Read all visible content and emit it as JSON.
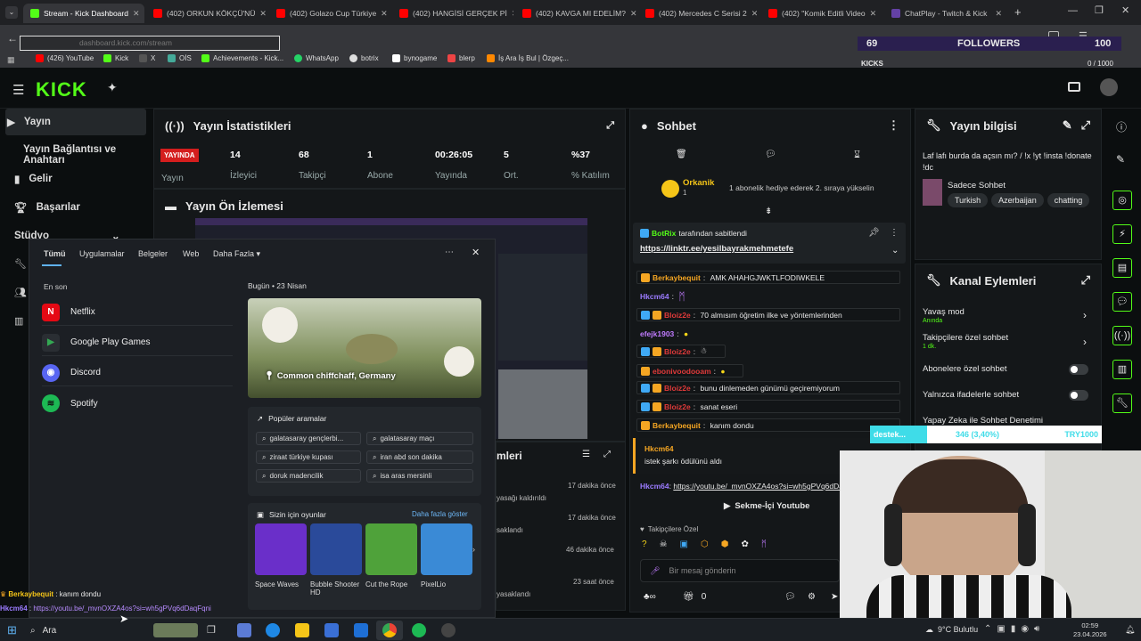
{
  "browser": {
    "tabs": [
      {
        "label": "Stream - Kick Dashboard",
        "active": true,
        "color": "#53fc18"
      },
      {
        "label": "(402) ORKUN KÖKÇÜ'NÜ",
        "color": "#ff0000"
      },
      {
        "label": "(402) Golazo Cup Türkiye",
        "color": "#ff0000"
      },
      {
        "label": "(402) HANGİSİ GERÇEK Pİ",
        "color": "#ff0000"
      },
      {
        "label": "(402) KAVGA MI EDELİM?",
        "color": "#ff0000"
      },
      {
        "label": "(402) Mercedes C Serisi 2",
        "color": "#ff0000"
      },
      {
        "label": "(402) \"Komik Editli Video",
        "color": "#ff0000"
      },
      {
        "label": "ChatPlay - Twitch & Kick",
        "color": "#6441a5"
      }
    ],
    "url": "dashboard.kick.com/stream",
    "bookmarks": [
      "(426) YouTube",
      "Kick",
      "X",
      "OİS",
      "Achievements - Kick...",
      "WhatsApp",
      "botrix",
      "bynogame",
      "blerp",
      "İş Ara İş Bul | Özgeç..."
    ]
  },
  "overlay": {
    "followers_count": "69",
    "followers_label": "FOLLOWERS",
    "goal_value": "100",
    "kicks_label": "KICKS",
    "kicks_value": "0 / 1000"
  },
  "sidebar": {
    "items": [
      "Yayın",
      "Yayın Bağlantısı ve Anahtarı",
      "Gelir",
      "Başarılar",
      "Stüdyo"
    ]
  },
  "stats": {
    "title": "Yayın İstatistikleri",
    "live_label": "YAYINDA",
    "live_sub": "Yayın",
    "cols": [
      {
        "value": "14",
        "label": "İzleyici"
      },
      {
        "value": "68",
        "label": "Takipçi"
      },
      {
        "value": "1",
        "label": "Abone"
      },
      {
        "value": "00:26:05",
        "label": "Yayında"
      },
      {
        "value": "5",
        "label": "Ort."
      },
      {
        "value": "%37",
        "label": "% Katılım"
      }
    ]
  },
  "preview": {
    "title": "Yayın Ön İzlemesi"
  },
  "activity": {
    "title": "mleri",
    "rows": [
      {
        "text": "yasağı kaldırıldı",
        "time": "17 dakika önce"
      },
      {
        "text": "",
        "time": "17 dakika önce"
      },
      {
        "text": "saklandı",
        "time": "46 dakika önce"
      },
      {
        "text": "",
        "time": "23 saat önce"
      },
      {
        "text": "yasaklandı",
        "time": ""
      }
    ]
  },
  "chat": {
    "title": "Sohbet",
    "top_user": "Orkanik",
    "top_rank": "1",
    "top_msg": "1 abonelik hediye ederek 2. sıraya yükselin",
    "pinned_by": "BotRix",
    "pinned_suffix": "tarafından sabitlendi",
    "pinned_link": "https://linktr.ee/yesilbayrakmehmetefe",
    "messages": [
      {
        "user": "Berkaybequit",
        "text": "AMK AHAHGJWKTLFODIWKELE",
        "color": "#f5a623"
      },
      {
        "user": "Hkcm64",
        "text": "",
        "color": "#9b7bff"
      },
      {
        "user": "Bloiz2e",
        "text": "70 almısım öğretim ilke ve yöntemlerinden",
        "color": "#e03a3a"
      },
      {
        "user": "efejk1903",
        "text": "",
        "color": "#c07bff"
      },
      {
        "user": "Bloiz2e",
        "text": "",
        "color": "#e03a3a"
      },
      {
        "user": "ebonivoodooam",
        "text": "",
        "color": "#e03a3a"
      },
      {
        "user": "Bloiz2e",
        "text": "bunu dinlemeden günümü geçiremiyorum",
        "color": "#e03a3a"
      },
      {
        "user": "Bloiz2e",
        "text": "sanat eseri",
        "color": "#e03a3a"
      },
      {
        "user": "Berkaybequit",
        "text": "kanım dondu",
        "color": "#f5a623"
      }
    ],
    "reply_user": "Hkcm64",
    "reply_text": "istek şarkı ödülünü aldı",
    "link_user": "Hkcm64",
    "link_text": "https://youtu.be/_mvnOXZA4os?si=wh5gPVq6dDaqFqni",
    "youtube_button": "Sekme-İçi Youtube",
    "followers_only": "Takipçilere Özel",
    "input_placeholder": "Bir mesaj gönderin",
    "viewer_count": "0"
  },
  "info": {
    "title": "Yayın bilgisi",
    "stream_title": "Laf lafı burda da açsın mı? / !x !yt !insta !donate !dc",
    "category": "Sadece Sohbet",
    "tags": [
      "Turkish",
      "Azerbaijan",
      "chatting"
    ]
  },
  "actions": {
    "title": "Kanal Eylemleri",
    "items": [
      {
        "label": "Yavaş mod",
        "sub": "Anında"
      },
      {
        "label": "Takipçilere özel sohbet",
        "sub": "1 dk."
      },
      {
        "label": "Abonelere özel sohbet",
        "sub": ""
      },
      {
        "label": "Yalnızca ifadelerle sohbet",
        "sub": ""
      },
      {
        "label": "Yapay Zeka ile Sohbet Denetimi",
        "sub": ""
      }
    ]
  },
  "donation": {
    "left": "destek...",
    "center": "346 (3,40%)",
    "right": "TRY1000"
  },
  "startmenu": {
    "tabs": [
      "Tümü",
      "Uygulamalar",
      "Belgeler",
      "Web",
      "Daha Fazla"
    ],
    "recent_label": "En son",
    "recent": [
      {
        "name": "Netflix",
        "color": "#e50914",
        "glyph": "N"
      },
      {
        "name": "Google Play Games",
        "color": "#2a2e33",
        "glyph": "▶"
      },
      {
        "name": "Discord",
        "color": "#5865f2",
        "glyph": "◉"
      },
      {
        "name": "Spotify",
        "color": "#1db954",
        "glyph": "≋"
      }
    ],
    "today": "Bugün",
    "date": "23 Nisan",
    "image_caption": "Common chiffchaff, Germany",
    "popular_title": "Popüler aramalar",
    "popular": [
      "galatasaray gençlerbi...",
      "galatasaray maçı",
      "ziraat türkiye kupası",
      "iran abd son dakika",
      "doruk madencilik",
      "isa aras mersinli"
    ],
    "games_title": "Sizin için oyunlar",
    "games_more": "Daha fazla göster",
    "games": [
      {
        "name": "Space Waves",
        "color": "#6a2fc9"
      },
      {
        "name": "Bubble Shooter HD",
        "color": "#2a4a9a"
      },
      {
        "name": "Cut the Rope",
        "color": "#4fa23a"
      },
      {
        "name": "PixelLio",
        "color": "#3a8ad6"
      }
    ]
  },
  "bottom_chat": {
    "line1_user": "Berkaybequit",
    "line1_text": "kanım dondu",
    "line2_user": "Hkcm64",
    "line2_text": "https://youtu.be/_mvnOXZA4os?si=wh5gPVq6dDaqFqni"
  },
  "taskbar": {
    "search": "Ara",
    "weather": "9°C Bulutlu",
    "time": "02:59",
    "date": "23.04.2026"
  }
}
